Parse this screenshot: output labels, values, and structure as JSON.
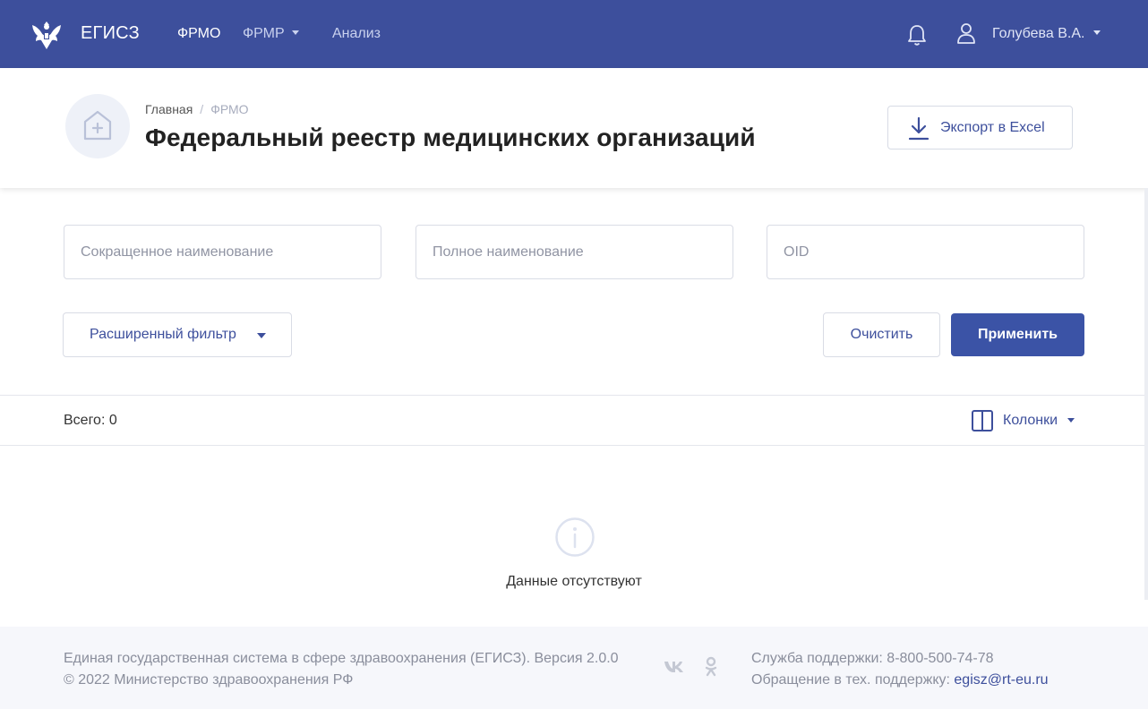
{
  "app": {
    "brand": "ЕГИСЗ",
    "logo_icon": "emblem-eagle-icon"
  },
  "nav": {
    "items": [
      {
        "label": "ФРМО",
        "active": true
      },
      {
        "label": "ФРМР",
        "has_dropdown": true
      },
      {
        "label": "Анализ"
      }
    ]
  },
  "user": {
    "name": "Голубева В.А.",
    "bell_icon": "bell-icon",
    "user_icon": "user-icon"
  },
  "header": {
    "breadcrumb": [
      "Главная",
      "ФРМО"
    ],
    "title": "Федеральный реестр медицинских организаций",
    "page_icon": "hospital-icon",
    "export_label": "Экспорт в Excel",
    "export_icon": "download-icon"
  },
  "filters": {
    "short_name_placeholder": "Сокращенное наименование",
    "short_name_value": "",
    "full_name_placeholder": "Полное наименование",
    "full_name_value": "",
    "oid_placeholder": "OID",
    "oid_value": "",
    "advanced_label": "Расширенный фильтр",
    "clear_label": "Очистить",
    "apply_label": "Применить"
  },
  "table": {
    "total": "Всего: 0",
    "columns_label": "Колонки",
    "columns_icon": "columns-icon",
    "empty_icon": "info-icon",
    "empty_text": "Данные отсутствуют"
  },
  "footer": {
    "system_text": "Единая государственная система в сфере здравоохранения (ЕГИСЗ). Версия 2.0.0",
    "copyright": "© 2022 Министерство здравоохранения РФ",
    "support_phone": "Служба поддержки: 8-800-500-74-78",
    "tech_support_label": "Обращение в тех. поддержку:",
    "tech_support_email": "egisz@rt-eu.ru",
    "social_icons": [
      "vk-icon",
      "odnoklassniki-icon"
    ]
  },
  "colors": {
    "primary": "#3d4f9c",
    "button": "#3b53a6",
    "footer_bg": "#f6f7fb"
  }
}
